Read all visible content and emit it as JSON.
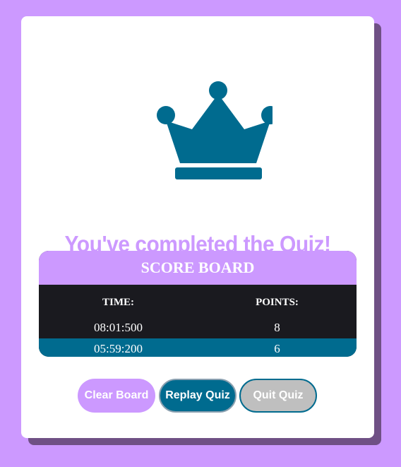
{
  "colors": {
    "background": "#cc99ff",
    "accent": "#cc99ff",
    "primary": "#006b8f",
    "table_dark": "#1a1a1f",
    "quit_gray": "#bfbfbf"
  },
  "icon": {
    "name": "crown-icon",
    "color": "#006b8f"
  },
  "result": {
    "title": "You've completed the Quiz!"
  },
  "scoreboard": {
    "title": "SCORE BOARD",
    "columns": [
      "TIME:",
      "POINTS:"
    ],
    "rows": [
      {
        "time": "08:01:500",
        "points": "8"
      },
      {
        "time": "05:59:200",
        "points": "6"
      }
    ]
  },
  "actions": {
    "clear_label": "Clear Board",
    "replay_label": "Replay Quiz",
    "quit_label": "Quit Quiz"
  }
}
